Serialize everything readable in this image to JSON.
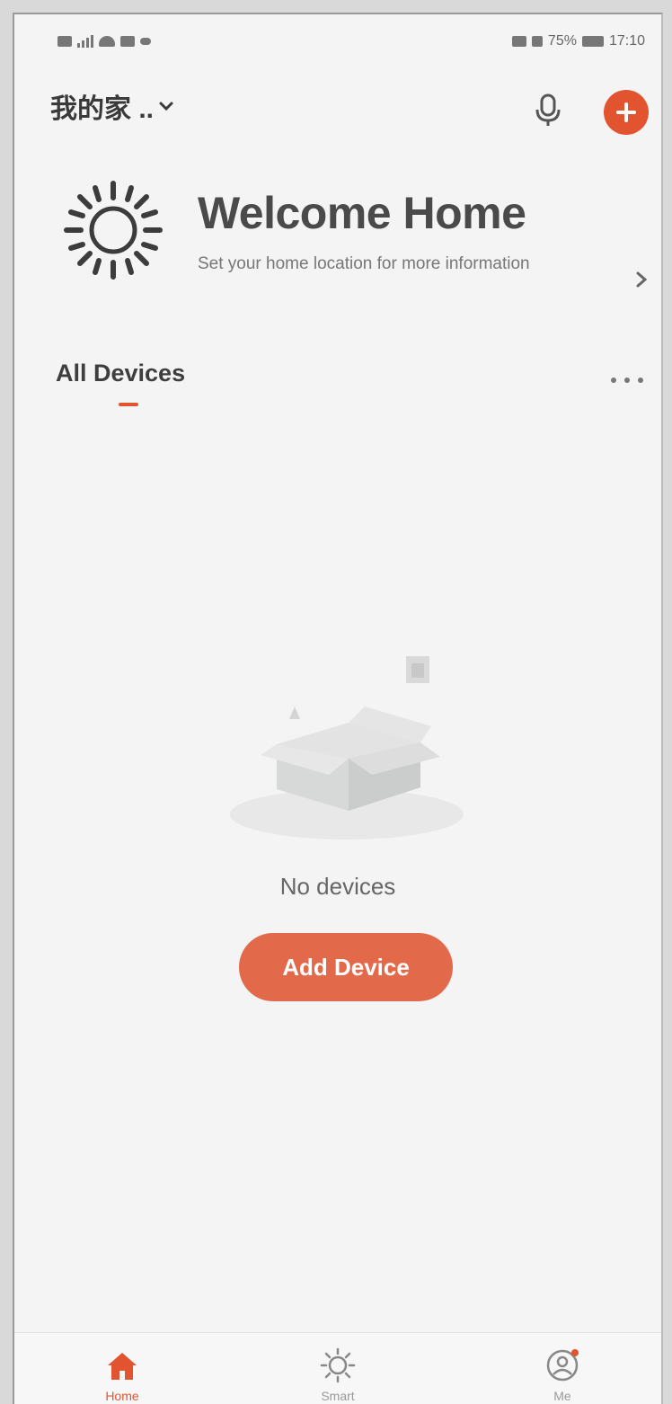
{
  "status_bar": {
    "battery": "75%",
    "time": "17:10"
  },
  "header": {
    "home_name": "我的家 ..",
    "mic_icon": "microphone-icon",
    "add_icon": "plus-circle-icon"
  },
  "welcome": {
    "title": "Welcome Home",
    "subtitle": "Set your home location for more information",
    "icon": "sun-icon"
  },
  "devices": {
    "section_title": "All Devices",
    "empty_text": "No devices",
    "add_button": "Add Device"
  },
  "tabs": [
    {
      "label": "Home",
      "icon": "home-icon",
      "active": true
    },
    {
      "label": "Smart",
      "icon": "smart-sun-icon",
      "active": false
    },
    {
      "label": "Me",
      "icon": "profile-icon",
      "active": false
    }
  ],
  "colors": {
    "accent": "#e2542f",
    "button": "#e26a4b",
    "background": "#f4f4f4",
    "text_dark": "#3e3e3e"
  }
}
